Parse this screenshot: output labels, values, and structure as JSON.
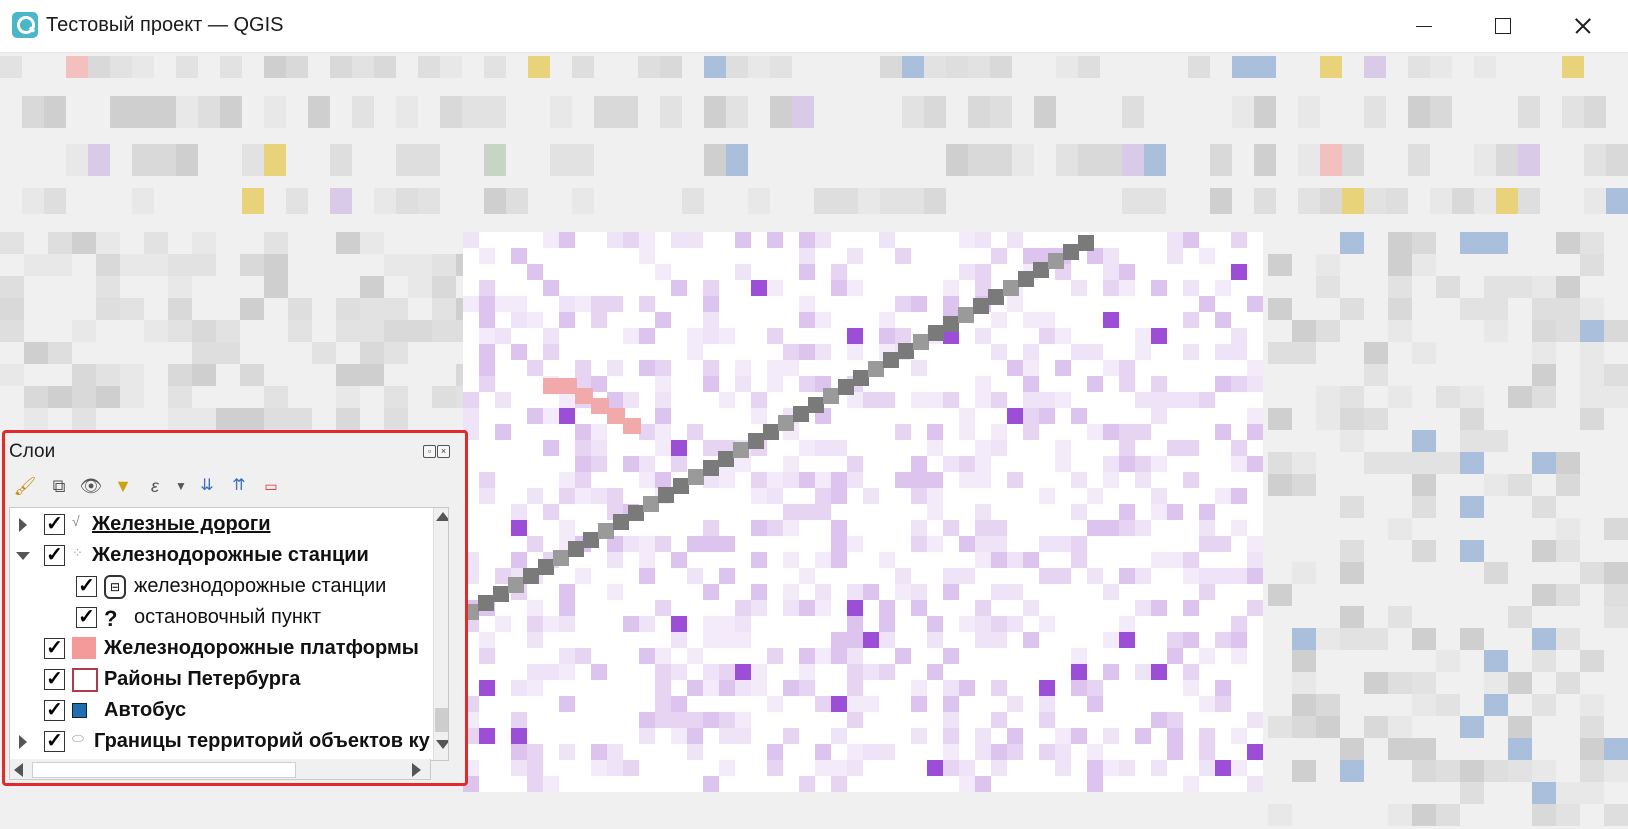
{
  "window": {
    "title": "Тестовый проект — QGIS",
    "minimize_icon": "minimize-icon",
    "maximize_icon": "maximize-icon",
    "close_icon": "close-icon"
  },
  "layers_panel": {
    "title": "Слои",
    "toolbar_icons": [
      "style-brush-icon",
      "add-group-icon",
      "visibility-eye-icon",
      "filter-icon",
      "expression-filter-icon",
      "dropdown-arrow-icon",
      "expand-all-icon",
      "collapse-all-icon",
      "remove-layer-icon"
    ],
    "layers": [
      {
        "label": "Железные дороги",
        "checked": true,
        "expander": "collapsed",
        "symbol": "line-icon",
        "bold": true,
        "underline": true,
        "indent": 0
      },
      {
        "label": "Железнодорожные станции",
        "checked": true,
        "expander": "expanded",
        "symbol": "point-icon",
        "bold": true,
        "underline": false,
        "indent": 0
      },
      {
        "label": "железнодорожные станции",
        "checked": true,
        "expander": "none",
        "symbol": "train-icon",
        "bold": false,
        "underline": false,
        "indent": 1
      },
      {
        "label": "остановочный пункт",
        "checked": true,
        "expander": "none",
        "symbol": "question-mark-icon",
        "bold": false,
        "underline": false,
        "indent": 1
      },
      {
        "label": "Железнодорожные платформы",
        "checked": true,
        "expander": "none",
        "symbol": "pink-fill-icon",
        "bold": true,
        "underline": false,
        "indent": 0
      },
      {
        "label": "Районы Петербурга",
        "checked": true,
        "expander": "none",
        "symbol": "outline-polygon-icon",
        "bold": true,
        "underline": false,
        "indent": 0
      },
      {
        "label": "Автобус",
        "checked": true,
        "expander": "none",
        "symbol": "blue-square-icon",
        "bold": true,
        "underline": false,
        "indent": 0
      },
      {
        "label": "Границы территорий объектов ку",
        "checked": true,
        "expander": "collapsed",
        "symbol": "polygon-icon",
        "bold": true,
        "underline": false,
        "indent": 0
      }
    ]
  },
  "colors": {
    "highlight_border": "#e02b2b",
    "platform_fill": "#f59a9a",
    "district_outline": "#b03a48",
    "bus_square": "#1f6fb0",
    "map_feature": "#9b4fd6",
    "railway": "#7a7a7a"
  }
}
